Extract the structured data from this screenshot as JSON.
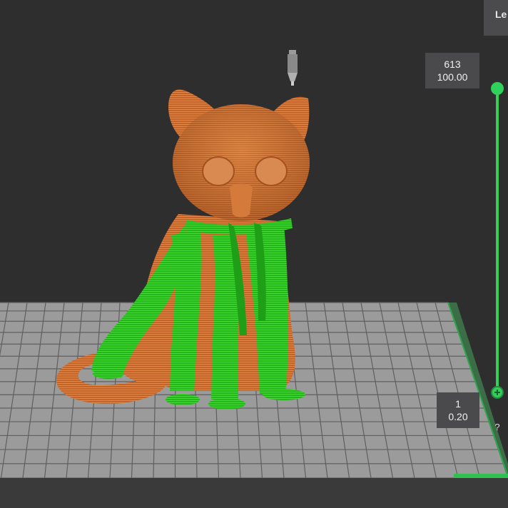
{
  "top_tab": {
    "label": "Le"
  },
  "layer_slider": {
    "top_layer": "613",
    "top_height": "100.00",
    "bottom_layer": "1",
    "bottom_height": "0.20",
    "accent_color": "#34d058"
  },
  "help_button": {
    "label": "?"
  },
  "icons": [
    "nozzle-icon",
    "help-icon"
  ],
  "colors": {
    "background": "#2e2e2f",
    "model": "#c96a2c",
    "support": "#27c21c",
    "grid": "#8c8c8c"
  }
}
